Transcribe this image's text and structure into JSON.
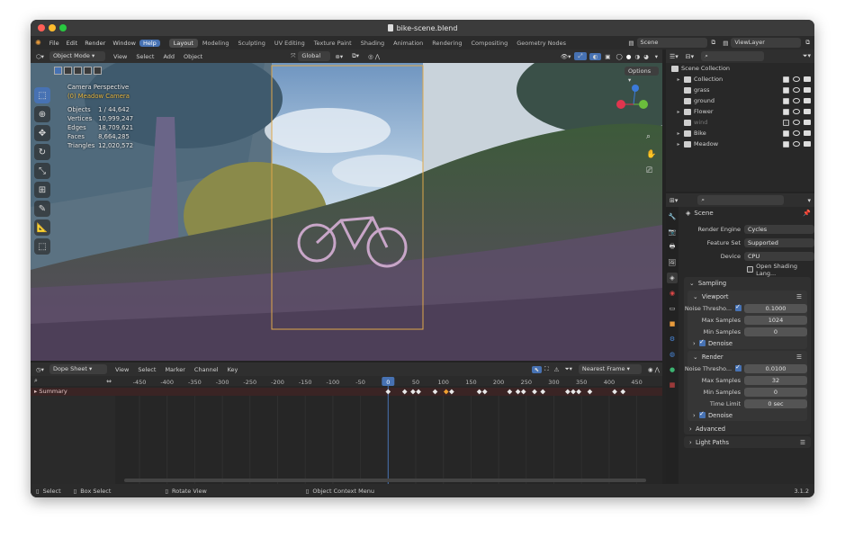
{
  "window": {
    "title": "bike-scene.blend"
  },
  "menu": [
    "File",
    "Edit",
    "Render",
    "Window",
    "Help"
  ],
  "workspaces": [
    "Layout",
    "Modeling",
    "Sculpting",
    "UV Editing",
    "Texture Paint",
    "Shading",
    "Animation",
    "Rendering",
    "Compositing",
    "Geometry Nodes"
  ],
  "scene": {
    "name": "Scene",
    "view_layer": "ViewLayer"
  },
  "viewport": {
    "mode": "Object Mode",
    "menu": [
      "View",
      "Select",
      "Add",
      "Object"
    ],
    "transform": "Global",
    "options": "Options",
    "perspective": "Camera Perspective",
    "camera": "(0) Meadow Camera",
    "stats": [
      {
        "k": "Objects",
        "v": "1 / 44,642"
      },
      {
        "k": "Vertices",
        "v": "10,999,247"
      },
      {
        "k": "Edges",
        "v": "18,709,621"
      },
      {
        "k": "Faces",
        "v": "8,664,285"
      },
      {
        "k": "Triangles",
        "v": "12,020,572"
      }
    ]
  },
  "dopesheet": {
    "mode": "Dope Sheet",
    "menu": [
      "View",
      "Select",
      "Marker",
      "Channel",
      "Key"
    ],
    "snap": "Nearest Frame",
    "ticks": [
      "-450",
      "-400",
      "-350",
      "-300",
      "-250",
      "-200",
      "-150",
      "-100",
      "-50",
      "0",
      "50",
      "100",
      "150",
      "200",
      "250",
      "300",
      "350",
      "400",
      "450"
    ],
    "current_frame": "0",
    "summary": "Summary"
  },
  "outliner": {
    "root": "Scene Collection",
    "items": [
      {
        "name": "Collection",
        "expanded": true,
        "checked": true
      },
      {
        "name": "grass",
        "expanded": false,
        "checked": true
      },
      {
        "name": "ground",
        "expanded": false,
        "checked": true
      },
      {
        "name": "Flower",
        "expanded": true,
        "checked": true
      },
      {
        "name": "wind",
        "expanded": false,
        "checked": false
      },
      {
        "name": "Bike",
        "expanded": true,
        "checked": true
      },
      {
        "name": "Meadow",
        "expanded": true,
        "checked": true
      }
    ]
  },
  "properties": {
    "context": "Scene",
    "render_engine_label": "Render Engine",
    "render_engine": "Cycles",
    "feature_set_label": "Feature Set",
    "feature_set": "Supported",
    "device_label": "Device",
    "device": "CPU",
    "osl": "Open Shading Lang...",
    "sampling": "Sampling",
    "viewport": "Viewport",
    "vp_noise_label": "Noise Thresho...",
    "vp_noise": "0.1000",
    "vp_max_label": "Max Samples",
    "vp_max": "1024",
    "vp_min_label": "Min Samples",
    "vp_min": "0",
    "denoise": "Denoise",
    "render": "Render",
    "r_noise_label": "Noise Thresho...",
    "r_noise": "0.0100",
    "r_max_label": "Max Samples",
    "r_max": "32",
    "r_min_label": "Min Samples",
    "r_min": "0",
    "r_time_label": "Time Limit",
    "r_time": "0 sec",
    "advanced": "Advanced",
    "light_paths": "Light Paths"
  },
  "statusbar": {
    "select": "Select",
    "box": "Box Select",
    "rotate": "Rotate View",
    "context": "Object Context Menu",
    "version": "3.1.2"
  }
}
